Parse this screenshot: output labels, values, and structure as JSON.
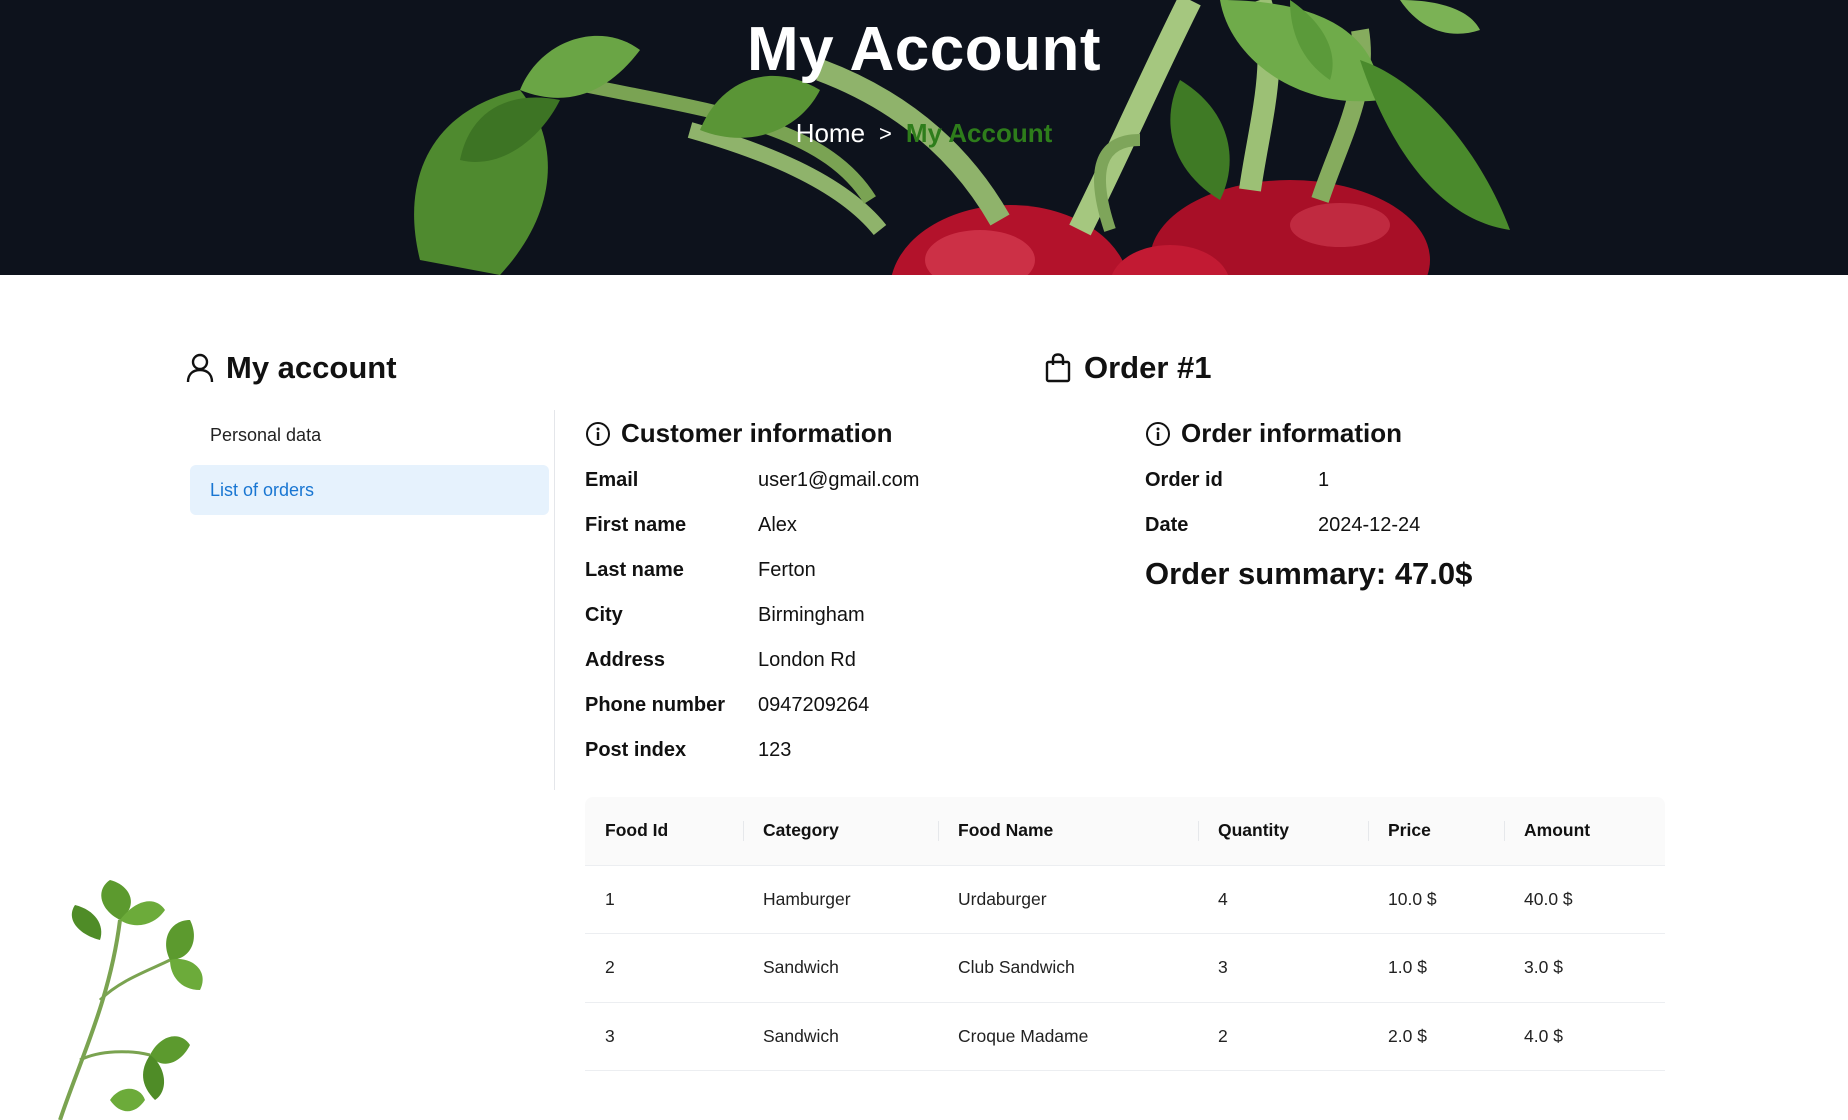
{
  "hero": {
    "title": "My Account",
    "breadcrumb_home": "Home",
    "breadcrumb_sep": ">",
    "breadcrumb_current": "My Account"
  },
  "sidebar": {
    "title": "My account",
    "items": [
      {
        "label": "Personal data"
      },
      {
        "label": "List of orders"
      }
    ]
  },
  "order": {
    "title": "Order #1",
    "customer_heading": "Customer information",
    "customer": [
      {
        "key": "Email",
        "value": "user1@gmail.com"
      },
      {
        "key": "First name",
        "value": "Alex"
      },
      {
        "key": "Last name",
        "value": "Ferton"
      },
      {
        "key": "City",
        "value": "Birmingham"
      },
      {
        "key": "Address",
        "value": "London Rd"
      },
      {
        "key": "Phone number",
        "value": "0947209264"
      },
      {
        "key": "Post index",
        "value": "123"
      }
    ],
    "info_heading": "Order information",
    "info": [
      {
        "key": "Order id",
        "value": "1"
      },
      {
        "key": "Date",
        "value": "2024-12-24"
      }
    ],
    "summary": "Order summary: 47.0$"
  },
  "table": {
    "headers": [
      "Food Id",
      "Category",
      "Food Name",
      "Quantity",
      "Price",
      "Amount"
    ],
    "rows": [
      [
        "1",
        "Hamburger",
        "Urdaburger",
        "4",
        "10.0 $",
        "40.0 $"
      ],
      [
        "2",
        "Sandwich",
        "Club Sandwich",
        "3",
        "1.0 $",
        "3.0 $"
      ],
      [
        "3",
        "Sandwich",
        "Croque Madame",
        "2",
        "2.0 $",
        "4.0 $"
      ]
    ]
  },
  "colors": {
    "hero_bg": "#0d121c",
    "accent_green": "#2e7d1b",
    "active_item_bg": "#e6f2fd",
    "active_item_text": "#1976d2"
  }
}
